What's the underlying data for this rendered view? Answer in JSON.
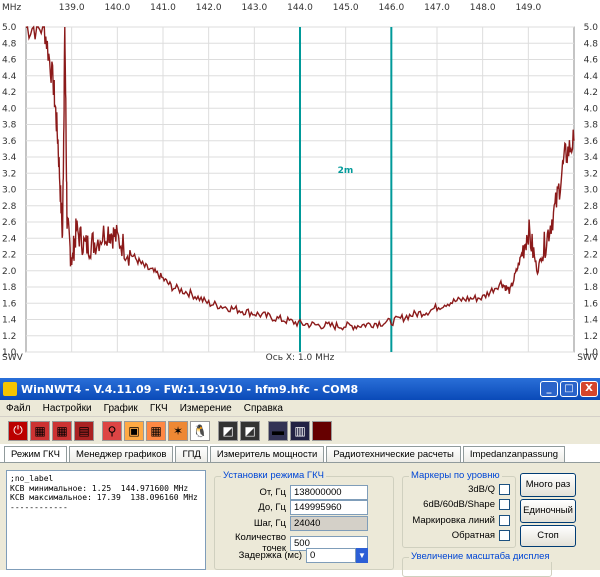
{
  "chart_data": {
    "type": "line",
    "x_unit": "MHz",
    "y_unit": "SWV",
    "xlim": [
      138.0,
      149.99996
    ],
    "ylim": [
      1.0,
      5.0
    ],
    "x_ticks": [
      "139.0",
      "140.0",
      "141.0",
      "142.0",
      "143.0",
      "144.0",
      "145.0",
      "146.0",
      "147.0",
      "148.0",
      "149.0"
    ],
    "y_ticks": [
      "5.0",
      "4.8",
      "4.6",
      "4.4",
      "4.2",
      "4.0",
      "3.8",
      "3.6",
      "3.4",
      "3.2",
      "3.0",
      "2.8",
      "2.6",
      "2.4",
      "2.2",
      "2.0",
      "1.8",
      "1.6",
      "1.4",
      "1.2",
      "1.0"
    ],
    "cursor_label": "Ось X: 1.0 MHz",
    "marker_label": "2m",
    "marker_lines": [
      144.0,
      146.0
    ],
    "grid": true,
    "series": [
      {
        "color": "#8b1a1a",
        "x": [
          138.0,
          138.4,
          138.6,
          138.7,
          138.8,
          138.85,
          138.9,
          139.0,
          139.1,
          139.3,
          139.5,
          139.8,
          140.0,
          140.3,
          140.6,
          140.9,
          141.2,
          141.6,
          142.0,
          142.4,
          142.8,
          143.2,
          143.6,
          144.0,
          144.4,
          144.8,
          145.2,
          145.6,
          146.0,
          146.4,
          146.8,
          147.2,
          147.6,
          148.0,
          148.4,
          148.6,
          148.8,
          149.0,
          149.2,
          149.4,
          149.6,
          149.8,
          150.0
        ],
        "y": [
          5.0,
          5.0,
          4.3,
          3.6,
          2.4,
          5.0,
          2.6,
          2.1,
          2.5,
          2.3,
          2.35,
          2.5,
          2.4,
          2.2,
          2.05,
          1.95,
          1.8,
          1.72,
          1.6,
          1.55,
          1.5,
          1.45,
          1.4,
          1.35,
          1.33,
          1.32,
          1.32,
          1.35,
          1.37,
          1.45,
          1.5,
          1.6,
          1.65,
          1.67,
          1.85,
          1.75,
          2.1,
          2.5,
          2.0,
          2.4,
          2.8,
          3.4,
          3.6
        ]
      }
    ]
  },
  "window": {
    "title": "WinNWT4 - V.4.11.09 - FW:1.19:V10 - hfm9.hfc - COM8",
    "min_glyph": "_",
    "max_glyph": "□",
    "close_glyph": "X"
  },
  "menu": [
    "Файл",
    "Настройки",
    "График",
    "ГКЧ",
    "Измерение",
    "Справка"
  ],
  "toolbar_icons": [
    "power-icon",
    "printer-icon",
    "printer-icon",
    "print-preview-icon",
    "probe-icon",
    "frame-icon",
    "grid-icon",
    "settings-icon",
    "penguin-icon",
    "chart-icon",
    "chart-icon",
    "cable-icon",
    "save-icon",
    "stop-icon"
  ],
  "tabs": [
    "Режим ГКЧ",
    "Менеджер графиков",
    "ГПД",
    "Измеритель мощности",
    "Радиотехнические расчеты",
    "Impedanzanpassung"
  ],
  "log": {
    "lines": [
      ";no_label",
      "",
      "КСВ минимальное: 1.25  144.971600 MHz",
      "КСВ максимальное: 17.39  138.096160 MHz",
      "------------"
    ]
  },
  "sweep": {
    "title": "Установки режима ГКЧ",
    "from_label": "От, Гц",
    "from_value": "138000000",
    "to_label": "До, Гц",
    "to_value": "149995960",
    "step_label": "Шаг, Гц",
    "step_value": "24040",
    "points_label": "Количество точек",
    "points_value": "500",
    "delay_label": "Задержка (мс)",
    "delay_value": "0"
  },
  "markers": {
    "title": "Маркеры по уровню",
    "items": [
      "3dB/Q",
      "6dB/60dB/Shape",
      "Маркировка линий",
      "Обратная"
    ]
  },
  "zoom": {
    "title": "Увеличение масштаба дисплея"
  },
  "buttons": {
    "multi": "Много раз",
    "single": "Единочный",
    "stop": "Стоп"
  }
}
